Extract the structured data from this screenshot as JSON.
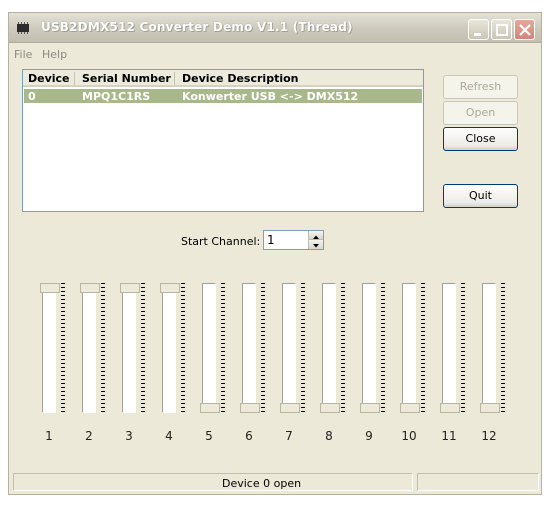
{
  "window": {
    "title": "USB2DMX512 Converter Demo V1.1 (Thread)"
  },
  "menu": [
    "File",
    "Help"
  ],
  "devices": {
    "columns": [
      "Device",
      "Serial Number",
      "Device Description"
    ],
    "rows": [
      {
        "device": "0",
        "serial": "MPQ1C1RS",
        "description": "Konwerter USB <-> DMX512"
      }
    ]
  },
  "buttons": {
    "refresh": "Refresh",
    "open": "Open",
    "close": "Close",
    "quit": "Quit"
  },
  "start_channel": {
    "label": "Start Channel:",
    "value": "1"
  },
  "faders": [
    {
      "number": "1",
      "level": 1.0
    },
    {
      "number": "2",
      "level": 1.0
    },
    {
      "number": "3",
      "level": 1.0
    },
    {
      "number": "4",
      "level": 1.0
    },
    {
      "number": "5",
      "level": 0.0
    },
    {
      "number": "6",
      "level": 0.0
    },
    {
      "number": "7",
      "level": 0.0
    },
    {
      "number": "8",
      "level": 0.0
    },
    {
      "number": "9",
      "level": 0.0
    },
    {
      "number": "10",
      "level": 0.0
    },
    {
      "number": "11",
      "level": 0.0
    },
    {
      "number": "12",
      "level": 0.0
    }
  ],
  "status": {
    "text": "Device 0 open"
  },
  "icons": {
    "app": "chip-icon",
    "minimize": "minimize-icon",
    "maximize": "maximize-icon",
    "close": "close-icon"
  }
}
